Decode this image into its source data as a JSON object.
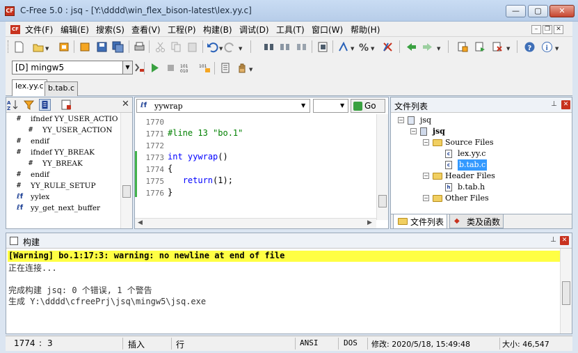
{
  "window": {
    "title": "C-Free 5.0 : jsq - [Y:\\dddd\\win_flex_bison-latest\\lex.yy.c]",
    "logo_text": "CF",
    "min_glyph": "—",
    "max_glyph": "▢",
    "close_glyph": "✕"
  },
  "menu": {
    "items": [
      "文件(F)",
      "编辑(E)",
      "搜索(S)",
      "查看(V)",
      "工程(P)",
      "构建(B)",
      "调试(D)",
      "工具(T)",
      "窗口(W)",
      "帮助(H)"
    ],
    "mdi_min": "–",
    "mdi_restore": "❐",
    "mdi_close": "✕"
  },
  "toolbar": {
    "target": "[D] mingw5",
    "dropdown_glyph": "▼"
  },
  "tabs": [
    "lex.yy.c",
    "b.tab.c"
  ],
  "symbols": {
    "rows": [
      {
        "kind": "hash",
        "text": "ifndef YY_USER_ACTIO",
        "indent": 1
      },
      {
        "kind": "hash",
        "text": "YY_USER_ACTION",
        "indent": 2
      },
      {
        "kind": "hash",
        "text": "endif",
        "indent": 1
      },
      {
        "kind": "hash",
        "text": "ifndef YY_BREAK",
        "indent": 1
      },
      {
        "kind": "hash",
        "text": "YY_BREAK",
        "indent": 2
      },
      {
        "kind": "hash",
        "text": "endif",
        "indent": 1
      },
      {
        "kind": "hash",
        "text": "YY_RULE_SETUP",
        "indent": 1
      },
      {
        "kind": "func",
        "text": "yylex",
        "indent": 1
      },
      {
        "kind": "func",
        "text": "yy_get_next_buffer",
        "indent": 1
      }
    ]
  },
  "editor": {
    "function": "yywrap",
    "go_label": "Go",
    "lines": [
      {
        "num": "1770",
        "code": ""
      },
      {
        "num": "1771",
        "code": "#line 13 \"bo.1\""
      },
      {
        "num": "1772",
        "code": ""
      },
      {
        "num": "1773",
        "code": "int yywrap()"
      },
      {
        "num": "1774",
        "code": "{"
      },
      {
        "num": "1775",
        "code": "   return(1);"
      },
      {
        "num": "1776",
        "code": "}"
      }
    ]
  },
  "file_list": {
    "title": "文件列表",
    "pin": "무",
    "nodes": [
      {
        "label": "jsq",
        "level": 0,
        "type": "workspace"
      },
      {
        "label": "jsq",
        "level": 1,
        "type": "project"
      },
      {
        "label": "Source Files",
        "level": 2,
        "type": "folder"
      },
      {
        "label": "lex.yy.c",
        "level": 3,
        "type": "file"
      },
      {
        "label": "b.tab.c",
        "level": 3,
        "type": "file-selected"
      },
      {
        "label": "Header Files",
        "level": 2,
        "type": "folder"
      },
      {
        "label": "b.tab.h",
        "level": 3,
        "type": "file"
      },
      {
        "label": "Other Files",
        "level": 2,
        "type": "folder"
      }
    ],
    "tab_files": "文件列表",
    "tab_classes": "类及函数"
  },
  "build": {
    "title": "构建",
    "lines": [
      "[Warning] bo.1:17:3: warning: no newline at end of file",
      "正在连接...",
      "",
      "完成构建 jsq: 0 个错误, 1 个警告",
      "生成 Y:\\dddd\\cfreePrj\\jsq\\mingw5\\jsq.exe"
    ]
  },
  "status": {
    "line": "1774",
    "col": "3",
    "insert": "插入",
    "mode": "行",
    "encoding": "ANSI",
    "eol": "DOS",
    "modified": "修改: 2020/5/18, 15:49:48",
    "size": "大小: 46,547"
  },
  "colors": {
    "accent": "#1c3f94",
    "warning_bg": "#ffff44",
    "selection": "#3399ff",
    "keyword": "#0000ff",
    "preproc": "#008000"
  }
}
